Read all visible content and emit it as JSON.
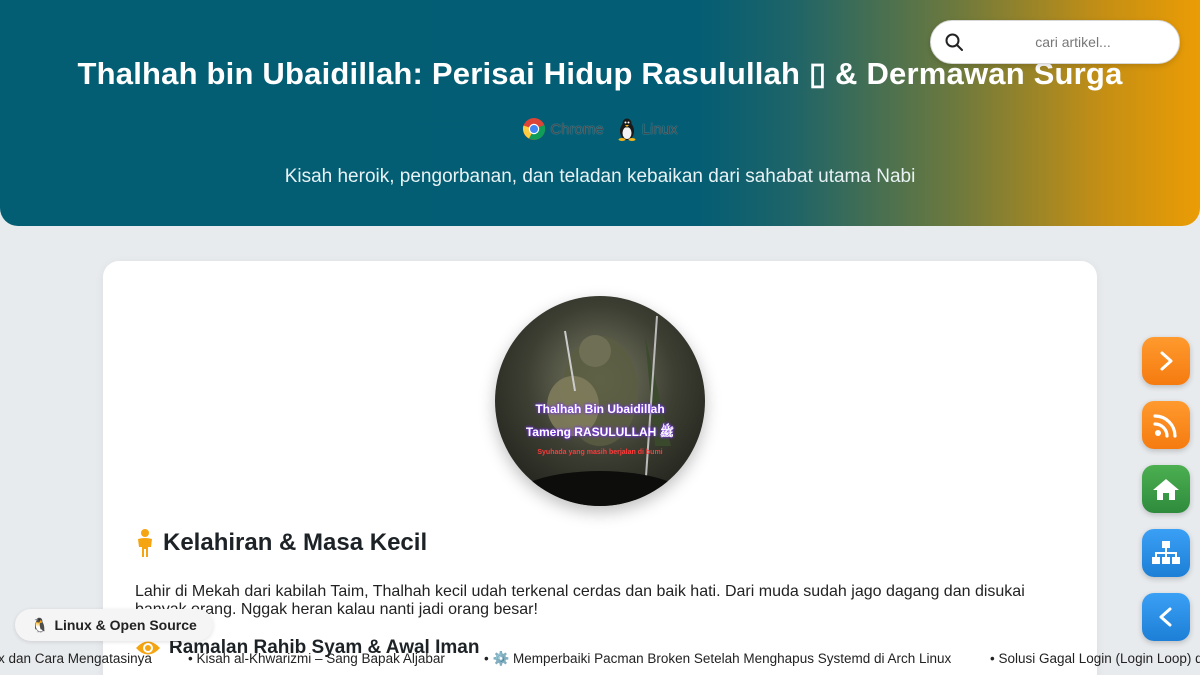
{
  "header": {
    "title": "Thalhah bin Ubaidillah: Perisai Hidup Rasulullah ▯ & Dermawan Surga",
    "subtitle": "Kisah heroik, pengorbanan, dan teladan kebaikan dari sahabat utama Nabi",
    "badges": [
      {
        "label": "Chrome",
        "icon": "chrome-icon"
      },
      {
        "label": "Linux",
        "icon": "tux-icon"
      }
    ],
    "colors": {
      "start": "#035e74",
      "end": "#eb9c05"
    }
  },
  "search": {
    "placeholder": "cari artikel..."
  },
  "article": {
    "image_text": {
      "line1": "Thalhah Bin Ubaidillah",
      "line2": "Tameng RASULULLAH ﷺ",
      "line3": "Syuhada yang masih berjalan di bumi"
    },
    "sections": [
      {
        "heading": "Kelahiran & Masa Kecil",
        "icon": "person-icon",
        "text": "Lahir di Mekah dari kabilah Taim, Thalhah kecil udah terkenal cerdas dan baik hati. Dari muda sudah jago dagang dan disukai banyak orang. Nggak heran kalau nanti jadi orang besar!"
      },
      {
        "heading": "Ramalan Rahib Syam & Awal Iman",
        "icon": "eye-icon"
      }
    ]
  },
  "side_buttons": [
    {
      "name": "next",
      "icon": "chevron-right-icon",
      "color": "#f58a1f"
    },
    {
      "name": "rss",
      "icon": "rss-icon",
      "color": "#f58a1f"
    },
    {
      "name": "home",
      "icon": "home-icon",
      "color": "#3f9e48"
    },
    {
      "name": "sitemap",
      "icon": "sitemap-icon",
      "color": "#2b8de6"
    },
    {
      "name": "prev",
      "icon": "chevron-left-icon",
      "color": "#2b8de6"
    }
  ],
  "footer": {
    "pill_label": "Linux & Open Source",
    "ticker": [
      "x dan Cara Mengatasinya",
      "• Kisah al-Khwarizmi – Sang Bapak Aljabar",
      "• ⚙️ Memperbaiki Pacman Broken Setelah Menghapus Systemd di Arch Linux",
      "• Solusi Gagal Login (Login Loop) d"
    ]
  }
}
